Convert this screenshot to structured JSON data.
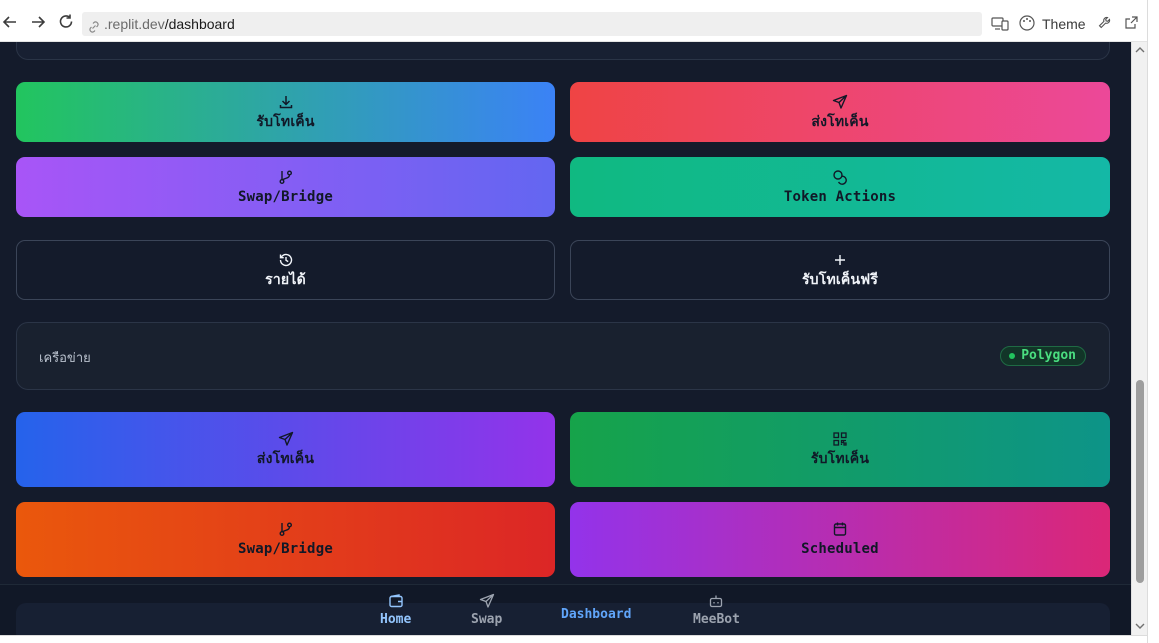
{
  "browser": {
    "url_host": ".replit.dev",
    "url_path": "/dashboard",
    "theme_label": "Theme"
  },
  "actions_top": [
    {
      "label": "รับโทเค็น",
      "icon": "download-icon",
      "gradient": [
        "#22c55e",
        "#3b82f6"
      ]
    },
    {
      "label": "ส่งโทเค็น",
      "icon": "send-icon",
      "gradient": [
        "#ef4444",
        "#ec4899"
      ]
    },
    {
      "label": "Swap/Bridge",
      "icon": "git-merge-icon",
      "gradient": [
        "#a855f7",
        "#6366f1"
      ]
    },
    {
      "label": "Token Actions",
      "icon": "coins-icon",
      "gradient": [
        "#10b981",
        "#14b8a6"
      ]
    },
    {
      "label": "รายได้",
      "icon": "history-icon"
    },
    {
      "label": "รับโทเค็นฟรี",
      "icon": "plus-icon"
    }
  ],
  "network": {
    "label": "เครือข่าย",
    "value": "Polygon",
    "status_color": "#22c55e"
  },
  "actions_bottom": [
    {
      "label": "ส่งโทเค็น",
      "icon": "send-icon",
      "gradient": [
        "#2563eb",
        "#9333ea"
      ]
    },
    {
      "label": "รับโทเค็น",
      "icon": "qr-code-icon",
      "gradient": [
        "#16a34a",
        "#0d9488"
      ]
    },
    {
      "label": "Swap/Bridge",
      "icon": "git-merge-icon",
      "gradient": [
        "#ea580c",
        "#dc2626"
      ]
    },
    {
      "label": "Scheduled",
      "icon": "calendar-icon",
      "gradient": [
        "#9333ea",
        "#db2777"
      ]
    }
  ],
  "bottom_nav": [
    {
      "label": "Home",
      "icon": "wallet-icon",
      "color": "#93c5fd"
    },
    {
      "label": "Swap",
      "icon": "send-icon",
      "color": "#9ca3af"
    },
    {
      "label": "Dashboard",
      "icon": "",
      "color": "#60a5fa"
    },
    {
      "label": "MeeBot",
      "icon": "bot-icon",
      "color": "#9ca3af"
    }
  ]
}
